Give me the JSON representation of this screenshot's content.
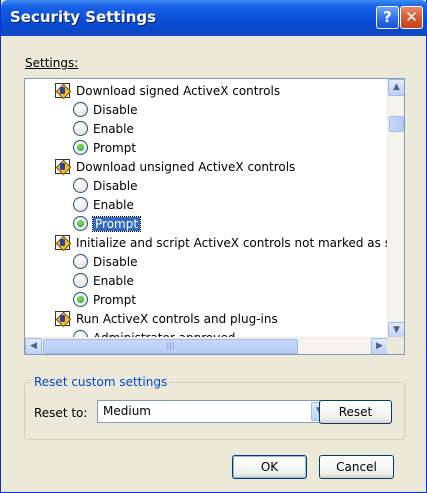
{
  "window": {
    "title": "Security Settings",
    "help_glyph": "?",
    "close_glyph": "✕"
  },
  "settings_label": "Settings:",
  "settings_list": [
    {
      "type": "category",
      "text": "Download signed ActiveX controls"
    },
    {
      "type": "option",
      "text": "Disable",
      "checked": false
    },
    {
      "type": "option",
      "text": "Enable",
      "checked": false
    },
    {
      "type": "option",
      "text": "Prompt",
      "checked": true
    },
    {
      "type": "category",
      "text": "Download unsigned ActiveX controls"
    },
    {
      "type": "option",
      "text": "Disable",
      "checked": false
    },
    {
      "type": "option",
      "text": "Enable",
      "checked": false
    },
    {
      "type": "option",
      "text": "Prompt",
      "checked": true,
      "selected": true
    },
    {
      "type": "category",
      "text": "Initialize and script ActiveX controls not marked as safe"
    },
    {
      "type": "option",
      "text": "Disable",
      "checked": false
    },
    {
      "type": "option",
      "text": "Enable",
      "checked": false
    },
    {
      "type": "option",
      "text": "Prompt",
      "checked": true
    },
    {
      "type": "category",
      "text": "Run ActiveX controls and plug-ins"
    },
    {
      "type": "option",
      "text": "Administrator approved",
      "checked": false
    }
  ],
  "scrollbar_glyphs": {
    "up": "▲",
    "down": "▼",
    "left": "◀",
    "right": "▶",
    "grip": "|||"
  },
  "reset_group": {
    "title": "Reset custom settings",
    "reset_to_label": "Reset to:",
    "reset_to_value": "Medium",
    "combo_arrow": "▼",
    "reset_button": "Reset"
  },
  "buttons": {
    "ok": "OK",
    "cancel": "Cancel"
  }
}
